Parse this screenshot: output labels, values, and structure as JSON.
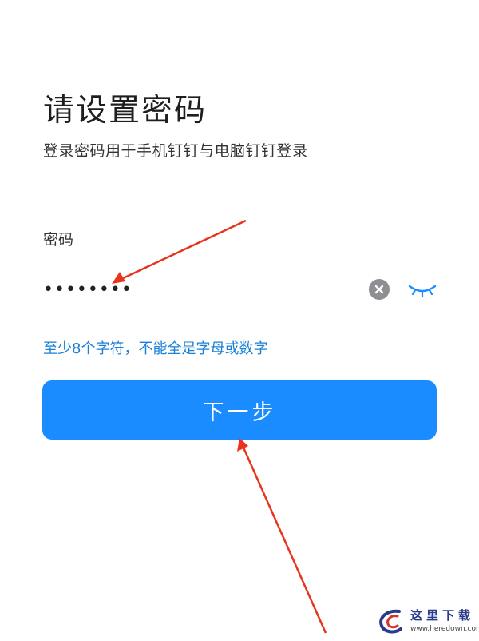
{
  "header": {
    "title": "请设置密码",
    "subtitle": "登录密码用于手机钉钉与电脑钉钉登录"
  },
  "password_field": {
    "label": "密码",
    "value": "••••••••",
    "clear_icon": "clear-circle-icon",
    "visibility_icon": "eye-closed-icon"
  },
  "hint": "至少8个字符，不能全是字母或数字",
  "next_button": {
    "label": "下一步"
  },
  "annotations": {
    "arrow_color": "#e8341c"
  },
  "watermark": {
    "title": "这里下载",
    "url": "www.heredown.com"
  },
  "colors": {
    "primary": "#1a8cff",
    "hint": "#1a7fd6",
    "text": "#1e1e1e"
  }
}
